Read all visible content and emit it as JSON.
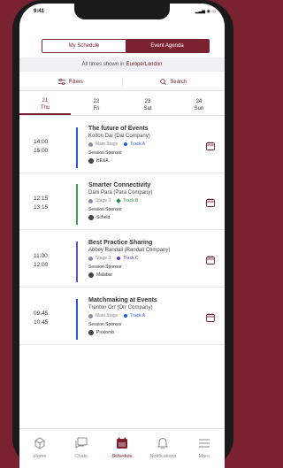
{
  "status": {
    "time": "9:41",
    "icons": "▂▃▅ ◉ ▭"
  },
  "segments": {
    "my": "My Schedule",
    "agenda": "Event Agenda"
  },
  "tz": {
    "prefix": "All times shown in",
    "location": "Europe/London"
  },
  "tools": {
    "filters": "Filters",
    "search": "Search"
  },
  "days": [
    {
      "num": "21",
      "name": "Thu"
    },
    {
      "num": "22",
      "name": "Fri"
    },
    {
      "num": "23",
      "name": "Sat"
    },
    {
      "num": "24",
      "name": "Sun"
    }
  ],
  "sponsor_label": "Session Sponsor",
  "sessions": [
    {
      "start": "14:00",
      "end": "15:00",
      "title": "The future of Events",
      "speaker": "Kolton Dai (Dai Company)",
      "room": "Main Stage",
      "track": "Track A",
      "track_color": "#2a5bd7",
      "bar_color": "#2a5bd7",
      "sponsor": "HEXA"
    },
    {
      "start": "12:15",
      "end": "13:15",
      "title": "Smarter Connectivity",
      "speaker": "Dani Para (Para Company)",
      "room": "Stage 3",
      "track": "Track B",
      "track_color": "#2e8b3e",
      "bar_color": "#3f9f4c",
      "sponsor": "Scheld"
    },
    {
      "start": "11:00",
      "end": "12:00",
      "title": "Best Practice Sharing",
      "speaker": "Abbey Randall (Randall Company)",
      "room": "Stage 3",
      "track": "Track C",
      "track_color": "#5a3fb0",
      "bar_color": "#6a4fc2",
      "sponsor": "Malabar"
    },
    {
      "start": "09:45",
      "end": "10:45",
      "title": "Matchmaking at Events",
      "speaker": "Trenton Orr (Orr Company)",
      "room": "Main Stage",
      "track": "Track A",
      "track_color": "#2a5bd7",
      "bar_color": "#2a5bd7",
      "sponsor": "Procomb"
    }
  ],
  "tabs": {
    "home": "Home",
    "chats": "Chats",
    "schedule": "Schedule",
    "notifications": "Notifications",
    "more": "More"
  },
  "colors": {
    "brand": "#7a2230"
  }
}
